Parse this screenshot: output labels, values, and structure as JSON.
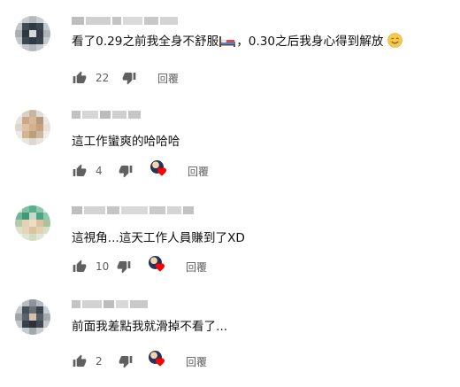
{
  "comments": [
    {
      "text_a": "看了0.29之前我全身不舒服",
      "text_b": "，0.30之后我身心得到解放",
      "like_count": "22",
      "reply_label": "回覆"
    },
    {
      "text": "這工作蠻爽的哈哈哈",
      "like_count": "4",
      "reply_label": "回覆"
    },
    {
      "text": "這視角...這天工作人員賺到了XD",
      "like_count": "10",
      "reply_label": "回覆"
    },
    {
      "text": "前面我差點我就滑掉不看了...",
      "like_count": "2",
      "reply_label": "回覆"
    }
  ],
  "icons": {
    "like": "thumb-up-icon",
    "dislike": "thumb-down-icon",
    "bed": "bed-emoji-icon",
    "smile": "smiling-face-emoji-icon",
    "heart": "creator-heart-icon"
  },
  "colors": {
    "text": "#0f0f0f",
    "meta": "#606060",
    "heart": "#ff0000"
  }
}
